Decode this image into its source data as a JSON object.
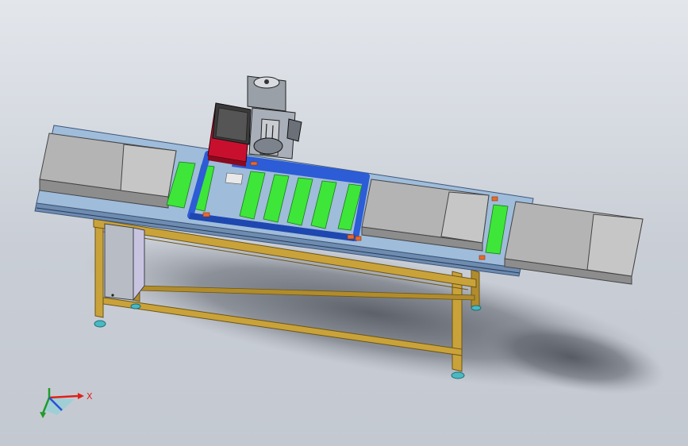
{
  "viewport": {
    "kind": "cad-3d-view"
  },
  "triad": {
    "x_axis_label": "X"
  },
  "colors": {
    "frame_blue": "#9fbcda",
    "frame_blue_dark": "#6e8bb0",
    "carriage_blue": "#2c5cd6",
    "belt_green": "#3ee63a",
    "guard_grey": "#a8a8a8",
    "guard_grey_dark": "#8a8a8a",
    "leg_gold": "#c9a33a",
    "cabinet_grey": "#b8bcc4",
    "toolbox_red": "#c8102e",
    "foot_cyan": "#49b9c3",
    "marker_orange": "#e86a2a"
  }
}
